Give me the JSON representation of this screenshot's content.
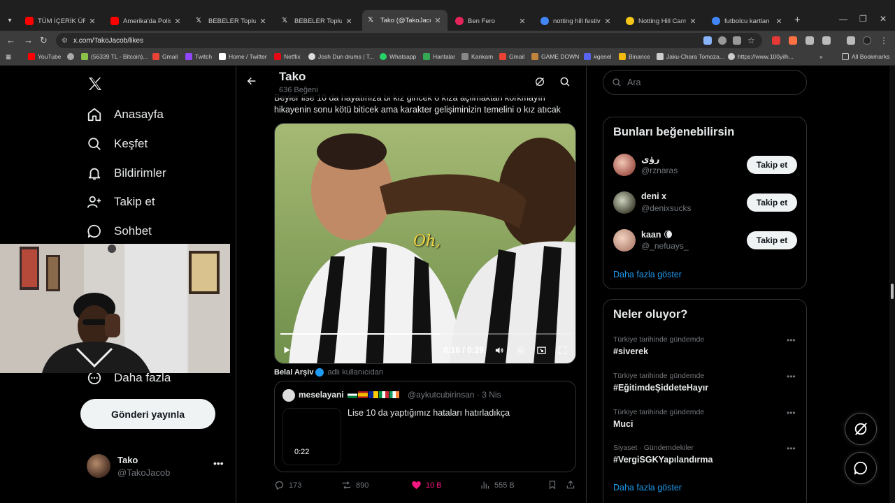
{
  "browser": {
    "tabs": [
      {
        "title": "TÜM İÇERİK ÜRETİCİ",
        "favicon": "youtube-icon",
        "color": "#ff0000"
      },
      {
        "title": "Amerika'da Polis KAT",
        "favicon": "youtube-icon",
        "color": "#ff0000"
      },
      {
        "title": "BEBELER Topluluk / X",
        "favicon": "x-icon",
        "color": "#ffffff"
      },
      {
        "title": "BEBELER Topluluk / X",
        "favicon": "x-icon",
        "color": "#ffffff"
      },
      {
        "title": "Tako (@TakoJacob) /",
        "favicon": "x-icon",
        "color": "#ffffff"
      },
      {
        "title": "Ben Fero",
        "favicon": "music-icon",
        "color": "#e5245a"
      },
      {
        "title": "notting hill festival -",
        "favicon": "google-icon",
        "color": "#4285f4"
      },
      {
        "title": "Notting Hill Carnival",
        "favicon": "emoji-icon",
        "color": "#f5c518"
      },
      {
        "title": "futbolcu kartları old",
        "favicon": "google-icon",
        "color": "#4285f4"
      }
    ],
    "url": "x.com/TakoJacob/likes",
    "bookmarks": [
      {
        "label": "YouTube",
        "color": "#ff0000"
      },
      {
        "label": "",
        "color": "#aaaaaa"
      },
      {
        "label": "(56339 TL - Bitcoin)...",
        "color": "#8bc34a"
      },
      {
        "label": "Gmail",
        "color": "#ea4335"
      },
      {
        "label": "Twitch",
        "color": "#9146ff"
      },
      {
        "label": "Home / Twitter",
        "color": "#ffffff"
      },
      {
        "label": "Netflix",
        "color": "#e50914"
      },
      {
        "label": "Josh Dun drums | T...",
        "color": "#dddddd"
      },
      {
        "label": "Whatsapp",
        "color": "#25d366"
      },
      {
        "label": "Haritalar",
        "color": "#34a853"
      },
      {
        "label": "Kankam",
        "color": "#888888"
      },
      {
        "label": "Gmail",
        "color": "#ea4335"
      },
      {
        "label": "GAME DOWN",
        "color": "#c0843d"
      },
      {
        "label": "#genel",
        "color": "#5865f2"
      },
      {
        "label": "Binance",
        "color": "#f0b90b"
      },
      {
        "label": "Jaku-Chara Tomoza...",
        "color": "#cccccc"
      },
      {
        "label": "https://www.100yilh...",
        "color": "#cccccc"
      }
    ],
    "all_bookmarks": "All Bookmarks"
  },
  "nav": {
    "items": [
      {
        "label": "Anasayfa",
        "icon": "home-icon"
      },
      {
        "label": "Keşfet",
        "icon": "search-icon"
      },
      {
        "label": "Bildirimler",
        "icon": "bell-icon"
      },
      {
        "label": "Takip et",
        "icon": "follow-icon"
      },
      {
        "label": "Sohbet",
        "icon": "chat-icon"
      },
      {
        "label": "Daha fazla",
        "icon": "more-icon"
      }
    ],
    "post_button": "Gönderi yayınla",
    "account": {
      "name": "Tako",
      "handle": "@TakoJacob"
    }
  },
  "header": {
    "title": "Tako",
    "subtitle": "636 Beğeni"
  },
  "tweet": {
    "text": "Beyler lise 10 da hayatınıza bi kız giricek o kıza açılmaktan korkmayın hikayenin sonu kötü biticek ama karakter gelişiminizin temelini o kız atıcak",
    "video_caption": "Oh,",
    "time": "0:16 / 0:29",
    "progress": 0.55,
    "source_name": "Belal Arşiv",
    "source_suffix": "adlı kullanıcıdan",
    "quote": {
      "name": "meselayani",
      "handle": "@aykutcubirinsan · 3 Nis",
      "text": "Lise 10 da yaptığımız hataları hatırladıkça",
      "duration": "0:22"
    },
    "stats": {
      "replies": "173",
      "reposts": "890",
      "likes": "10 B",
      "views": "555 B"
    }
  },
  "right": {
    "search_placeholder": "Ara",
    "suggest_title": "Bunları beğenebilirsin",
    "suggestions": [
      {
        "name": "رؤى",
        "handle": "@rznaras",
        "button": "Takip et"
      },
      {
        "name": "deni x",
        "handle": "@denixsucks",
        "button": "Takip et"
      },
      {
        "name": "kaan 🌘",
        "handle": "@_nefuays_",
        "button": "Takip et"
      }
    ],
    "show_more": "Daha fazla göster",
    "trends_title": "Neler oluyor?",
    "trends": [
      {
        "context": "Türkiye tarihinde gündemde",
        "tag": "#siverek"
      },
      {
        "context": "Türkiye tarihinde gündemde",
        "tag": "#EğitimdeŞiddeteHayır"
      },
      {
        "context": "Türkiye tarihinde gündemde",
        "tag": "Muci"
      },
      {
        "context": "Siyaset · Gündemdekiler",
        "tag": "#VergiSGKYapılandırma"
      }
    ],
    "trends_more": "Daha fazla göster"
  }
}
